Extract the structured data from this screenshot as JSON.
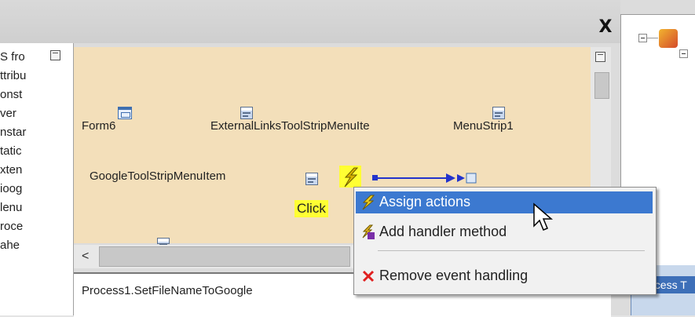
{
  "window": {
    "close_glyph": "X"
  },
  "left_panel": {
    "items": [
      "S fro",
      "ttribu",
      "onst",
      "ver",
      "nstar",
      "tatic",
      "xten",
      "ioog",
      "lenu",
      "roce",
      "ahe"
    ]
  },
  "designer": {
    "components": {
      "form6": "Form6",
      "external_links": "ExternalLinksToolStripMenuIte",
      "menu_strip": "MenuStrip1",
      "google_item": "GoogleToolStripMenuItem"
    },
    "event_label": "Click",
    "scroll_left_glyph": "<"
  },
  "bottom_panel": {
    "text": "Process1.SetFileNameToGoogle"
  },
  "context_menu": {
    "items": [
      {
        "label": "Assign actions",
        "icon": "lightning-icon",
        "highlighted": true
      },
      {
        "label": "Add handler method",
        "icon": "add-handler-icon",
        "highlighted": false
      },
      {
        "label": "Remove event handling",
        "icon": "red-x-icon",
        "highlighted": false
      }
    ]
  },
  "right_pane": {
    "tab_label": "ocess T"
  },
  "colors": {
    "designer_bg": "#f3dfba",
    "highlight": "#3c79d0",
    "event_badge": "#ffff33",
    "remove_icon": "#e02020"
  }
}
